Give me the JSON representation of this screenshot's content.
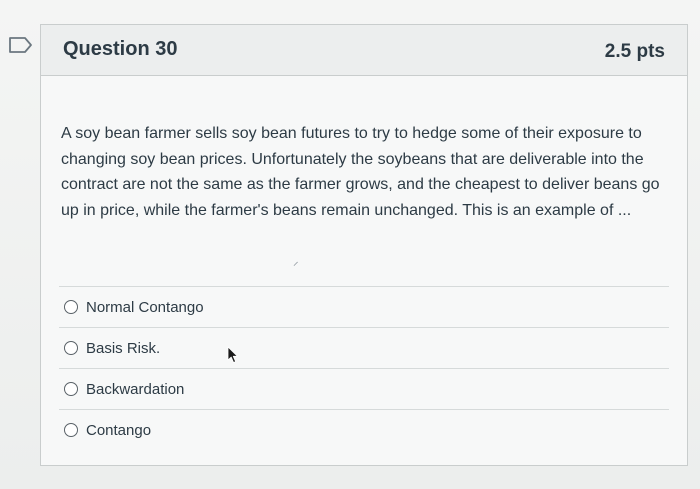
{
  "question": {
    "title": "Question 30",
    "points": "2.5 pts",
    "text": "A soy bean farmer sells soy bean futures to try to hedge some of their exposure to changing soy bean prices.  Unfortunately the soybeans that are deliverable into the contract are not the same as the farmer grows, and the cheapest to deliver beans go up in price, while the farmer's beans remain unchanged.  This is an example of ...",
    "stray_mark": "⸝"
  },
  "answers": [
    {
      "label": "Normal Contango"
    },
    {
      "label": "Basis Risk."
    },
    {
      "label": "Backwardation"
    },
    {
      "label": "Contango"
    }
  ],
  "icons": {
    "flag": "bookmark-flag-icon",
    "cursor": "mouse-pointer-icon"
  },
  "colors": {
    "text": "#2d3b45",
    "header_bg": "#eceeee",
    "border": "#c9cdcd"
  }
}
